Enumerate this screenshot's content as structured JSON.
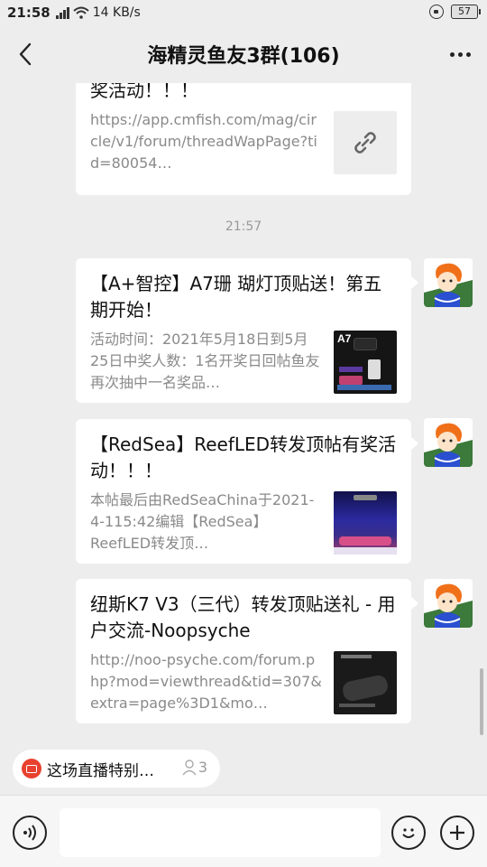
{
  "status_bar": {
    "time": "21:58",
    "network": "4G",
    "speed": "14 KB/s",
    "battery": "57"
  },
  "header": {
    "title": "海精灵鱼友3群(106)"
  },
  "messages": [
    {
      "title": "奖活动！！！",
      "desc": "https://app.cmfish.com/mag/circle/v1/forum/threadWapPage?tid=80054…",
      "thumb": "link-icon"
    },
    {
      "title": "【A+智控】A7珊 瑚灯顶贴送！第五期开始！",
      "desc": "活动时间：2021年5月18日到5月25日中奖人数：1名开奖日回帖鱼友再次抽中一名奖品…",
      "thumb": "A7"
    },
    {
      "title": "【RedSea】ReefLED转发顶帖有奖活动！！！",
      "desc": "本帖最后由RedSeaChina于2021-4-115:42编辑【RedSea】ReefLED转发顶…",
      "thumb": "reef-tank-image"
    },
    {
      "title": "纽斯K7 V3（三代）转发顶贴送礼 - 用户交流-Noopsyche",
      "desc": "http://noo-psyche.com/forum.php?mod=viewthread&tid=307&extra=page%3D1&mo…",
      "thumb": "k7-light-image"
    }
  ],
  "timestamp": "21:57",
  "live_chip": {
    "text": "这场直播特别…",
    "count": "3"
  },
  "colors": {
    "background": "#ededed",
    "bubble": "#ffffff",
    "live_red": "#e8412f"
  }
}
